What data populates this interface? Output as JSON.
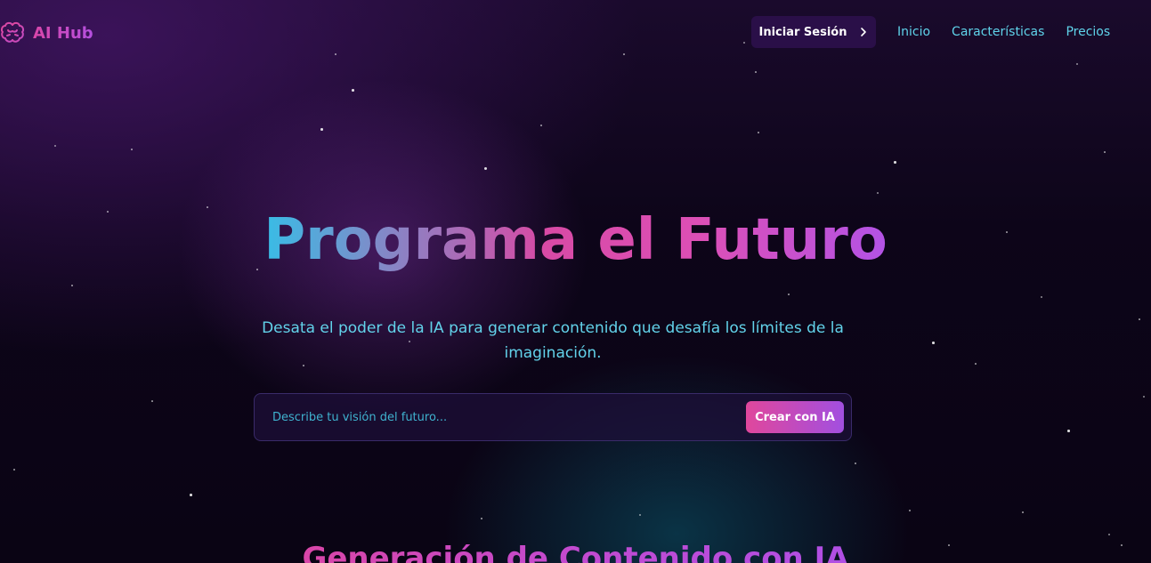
{
  "header": {
    "logo_text": "AI Hub",
    "logo_icon": "brain-icon",
    "login_label": "Iniciar Sesión",
    "nav": [
      "Inicio",
      "Características",
      "Precios"
    ]
  },
  "hero": {
    "title": "Programa el Futuro",
    "subtitle": "Desata el poder de la IA para generar contenido que desafía los límites de la imaginación.",
    "input_placeholder": "Describe tu visión del futuro...",
    "create_label": "Crear con IA"
  },
  "section": {
    "title": "Generación de Contenido con IA"
  },
  "colors": {
    "accent_pink": "#d946a8",
    "accent_purple": "#b353e6",
    "accent_cyan": "#5fd3ea",
    "background": "#0a0414"
  }
}
